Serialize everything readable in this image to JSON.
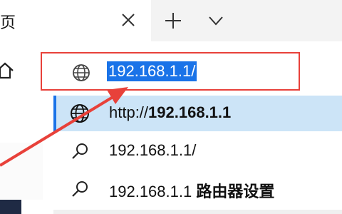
{
  "tab": {
    "title_fragment": "页",
    "close_icon": "close-icon",
    "new_tab_icon": "plus-icon",
    "dropdown_icon": "chevron-down-icon"
  },
  "toolbar": {
    "home_icon": "home-icon",
    "address": {
      "icon": "globe-icon",
      "value": "192.168.1.1/"
    }
  },
  "suggestions": [
    {
      "icon": "globe-icon",
      "prefix": "http://",
      "bold": "192.168.1.1",
      "selected": true
    },
    {
      "icon": "search-icon",
      "text": "192.168.1.1/"
    },
    {
      "icon": "search-icon",
      "text": "192.168.1.1 ",
      "bold": "路由器设置"
    }
  ],
  "colors": {
    "highlight_box": "#e8413a",
    "selection": "#1a73e8",
    "selected_row": "#cce4f7"
  }
}
